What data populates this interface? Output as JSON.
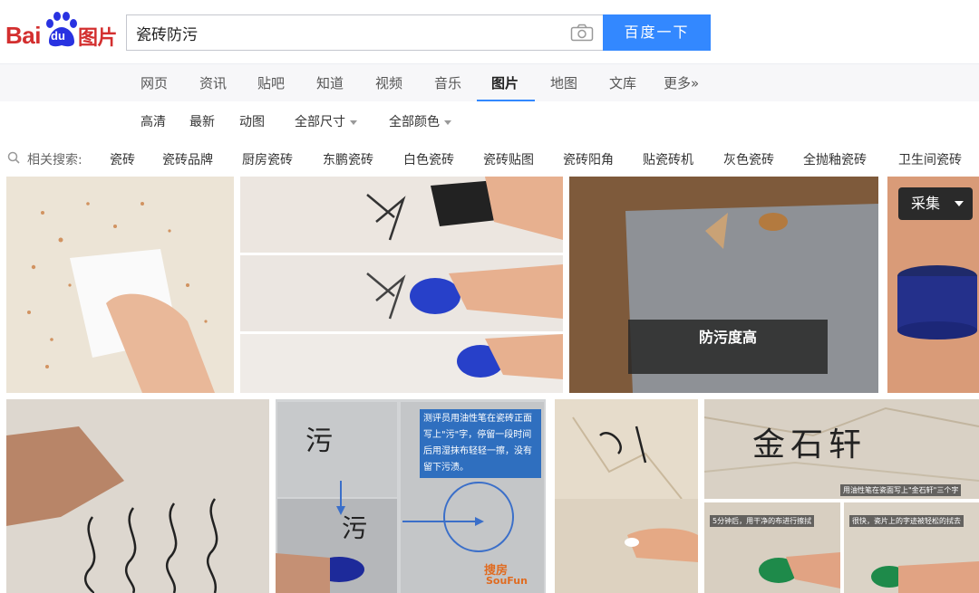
{
  "brand": {
    "bai": "Bai",
    "du": "du",
    "tupian": "图片",
    "red": "#d32f2f",
    "blue": "#3388ff"
  },
  "search": {
    "value": "瓷砖防污",
    "button": "百度一下",
    "camera_icon": "camera-icon"
  },
  "nav": {
    "tabs": [
      "网页",
      "资讯",
      "贴吧",
      "知道",
      "视频",
      "音乐",
      "图片",
      "地图",
      "文库",
      "更多»"
    ],
    "active": "图片"
  },
  "filters": [
    "高清",
    "最新",
    "动图",
    "全部尺寸",
    "全部颜色"
  ],
  "related": {
    "label": "相关搜索:",
    "items": [
      "瓷砖",
      "瓷砖品牌",
      "厨房瓷砖",
      "东鹏瓷砖",
      "白色瓷砖",
      "瓷砖贴图",
      "瓷砖阳角",
      "贴瓷砖机",
      "灰色瓷砖",
      "全抛釉瓷砖",
      "卫生间瓷砖"
    ]
  },
  "results": {
    "collect_button": "采集",
    "caption_main": "防污度高",
    "blue_note": "测评员用油性笔在瓷砖正面写上\"污\"字，停留一段时间后用湿抹布轻轻一擦，没有留下污渍。",
    "handwriting": [
      "污",
      "污",
      "金石轩"
    ],
    "caption_1": "用油性笔在瓷面写上\"金石轩\"三个字",
    "caption_2": "5分钟后，用干净的布进行擦拭",
    "caption_3": "很快，瓷片上的字迹被轻松的拭去",
    "watermark_soufun": "SouFun",
    "watermark_soufun_cn": "搜房"
  }
}
